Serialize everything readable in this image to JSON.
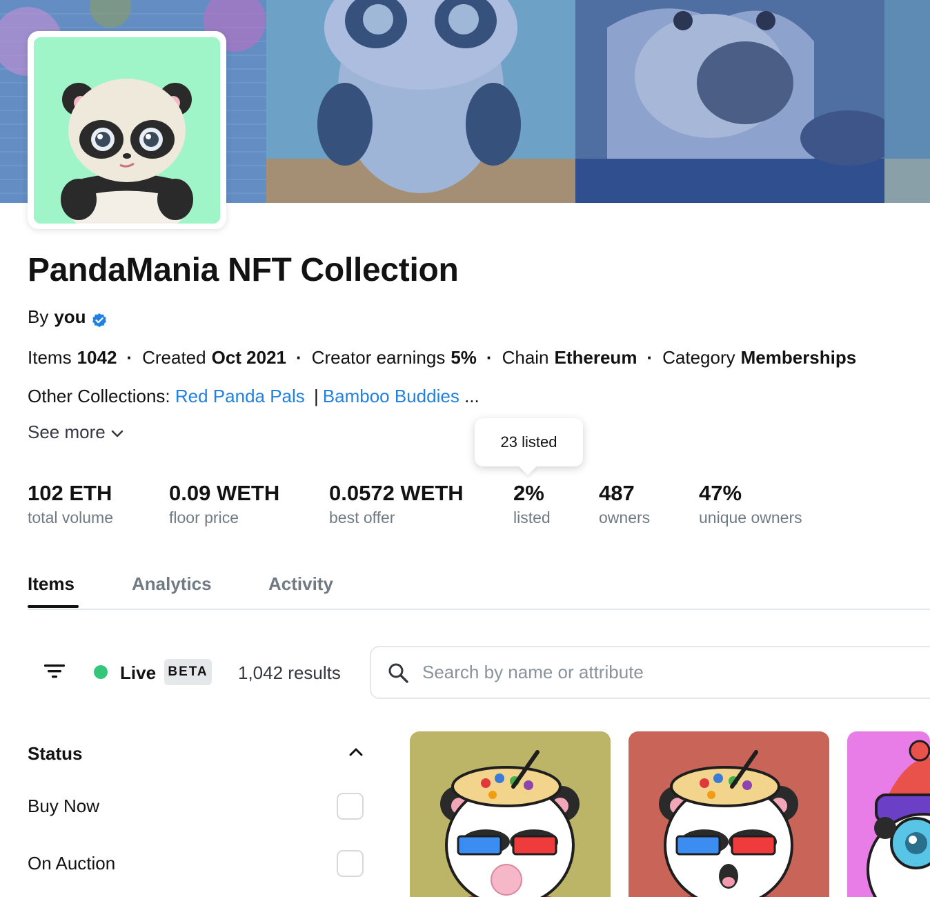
{
  "collection": {
    "title": "PandaMania NFT Collection",
    "by_prefix": "By",
    "creator": "you",
    "verified_icon": "verified-badge-icon",
    "meta": [
      {
        "label": "Items",
        "value": "1042"
      },
      {
        "label": "Created",
        "value": "Oct 2021"
      },
      {
        "label": "Creator earnings",
        "value": "5%"
      },
      {
        "label": "Chain",
        "value": "Ethereum"
      },
      {
        "label": "Category",
        "value": "Memberships"
      }
    ],
    "meta_separator": "·",
    "other_collections_label": "Other Collections:",
    "other_collections": [
      "Red Panda Pals",
      "Bamboo Buddies"
    ],
    "other_collections_pipe": "|",
    "other_collections_more": "...",
    "see_more": "See more"
  },
  "tooltip": "23 listed",
  "stats": [
    {
      "value": "102 ETH",
      "label": "total volume"
    },
    {
      "value": "0.09 WETH",
      "label": "floor price"
    },
    {
      "value": "0.0572 WETH",
      "label": "best offer"
    },
    {
      "value": "2%",
      "label": "listed"
    },
    {
      "value": "487",
      "label": "owners"
    },
    {
      "value": "47%",
      "label": "unique owners"
    }
  ],
  "tabs": [
    "Items",
    "Analytics",
    "Activity"
  ],
  "active_tab": "Items",
  "toolbar": {
    "live_label": "Live",
    "beta_label": "BETA",
    "results": "1,042 results",
    "search_placeholder": "Search by name or attribute"
  },
  "filters": {
    "status_heading": "Status",
    "options": [
      "Buy Now",
      "On Auction"
    ]
  },
  "colors": {
    "link": "#2081e2",
    "live": "#34c77b",
    "muted": "#707a83",
    "verified": "#2081e2"
  },
  "cards": [
    {
      "bg": "#bcb466"
    },
    {
      "bg": "#c96458"
    },
    {
      "bg": "#e97de8"
    }
  ]
}
